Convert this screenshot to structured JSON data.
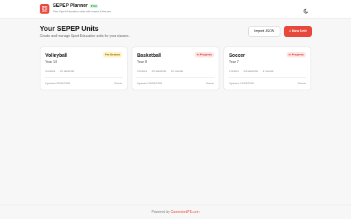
{
  "header": {
    "app_title": "SEPEP Planner",
    "badge": "Free",
    "subtitle": "Plan Sport Education units with teams & fixtures",
    "theme_icon": "moon-icon"
  },
  "main": {
    "title": "Your SEPEP Units",
    "subtitle": "Create and manage Sport Education units for your classes.",
    "import_label": "Import JSON",
    "new_label": "+ New Unit"
  },
  "units": [
    {
      "name": "Volleyball",
      "year": "Year 10",
      "status": "Pre-Season",
      "teams": "4 teams",
      "students": "20 students",
      "rounds": "",
      "updated": "Updated 26/03/2026",
      "delete_label": "Delete"
    },
    {
      "name": "Basketball",
      "year": "Year 8",
      "status": "In Progress",
      "teams": "4 teams",
      "students": "20 students",
      "rounds": "15 rounds",
      "updated": "Updated 26/03/2026",
      "delete_label": "Delete"
    },
    {
      "name": "Soccer",
      "year": "Year 7",
      "status": "In Progress",
      "teams": "4 teams",
      "students": "24 students",
      "rounds": "1 rounds",
      "updated": "Updated 24/03/2026",
      "delete_label": "Delete"
    }
  ],
  "footer": {
    "prefix": "Powered by",
    "link": "ConnectedPE.com"
  },
  "colors": {
    "accent": "#e8473b",
    "pre_season_bg": "#fdf3c4",
    "in_progress_bg": "#fde5e3"
  }
}
